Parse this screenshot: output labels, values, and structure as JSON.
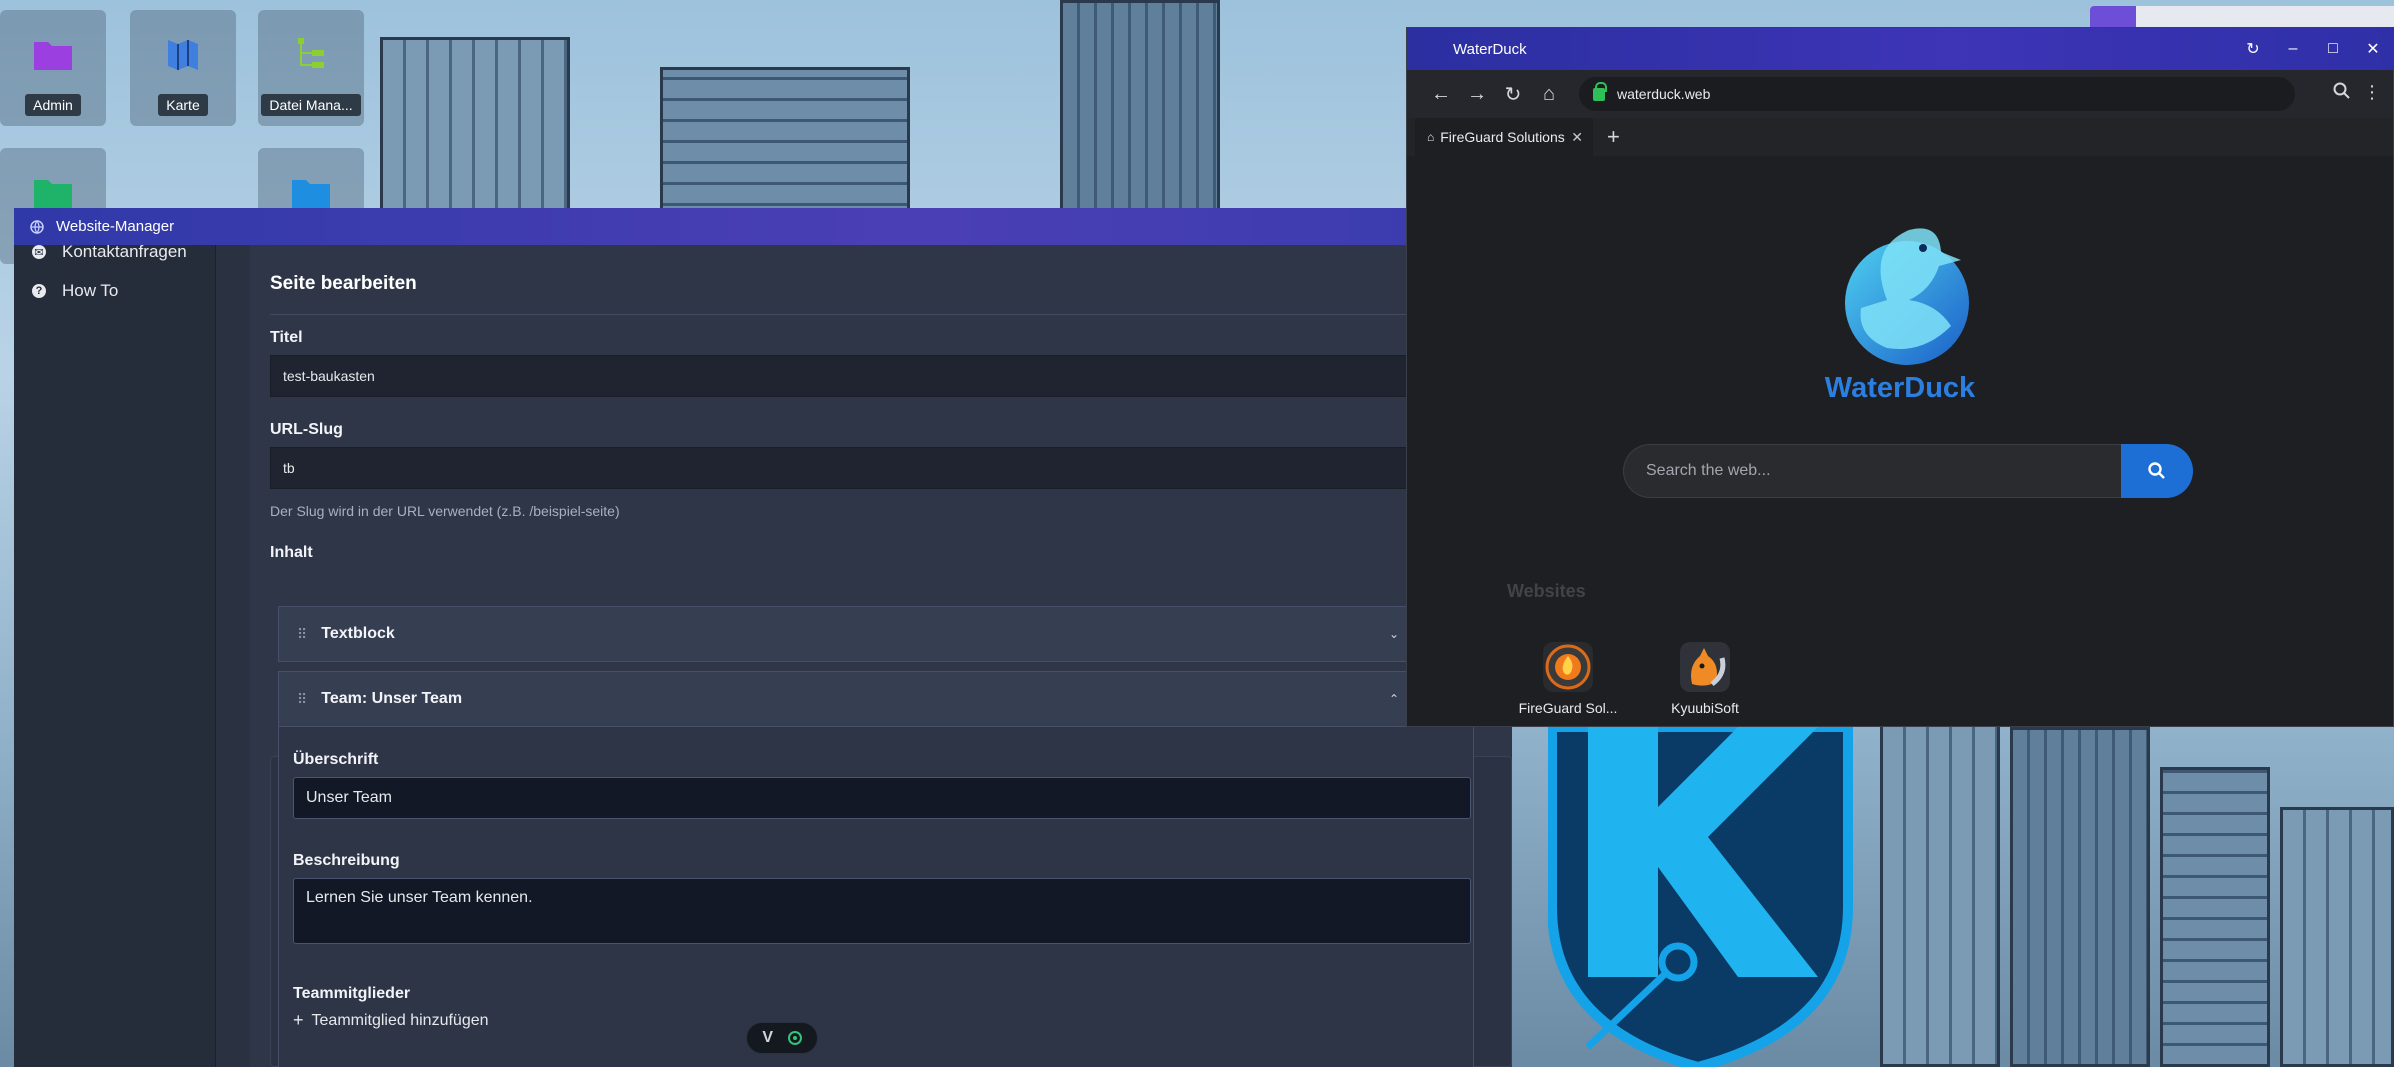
{
  "desktop": {
    "icons": [
      {
        "label": "Admin",
        "icon": "folder-icon",
        "color": "#9b3fe0"
      },
      {
        "label": "Karte",
        "icon": "map-icon",
        "color": "#3f7fe0"
      },
      {
        "label": "Datei Mana...",
        "icon": "file-tree-icon",
        "color": "#8bcf32"
      },
      {
        "label": "",
        "icon": "folder-icon",
        "color": "#1fb36a"
      },
      {
        "label": "",
        "icon": "folder-icon",
        "color": "#1e8fe0"
      }
    ]
  },
  "website_manager": {
    "title": "Website-Manager",
    "sidebar": [
      {
        "label": "Kontaktanfragen",
        "icon": "mail-icon"
      },
      {
        "label": "How To",
        "icon": "help-icon"
      }
    ],
    "section_title": "Seite bearbeiten",
    "fields": {
      "title_label": "Titel",
      "title_value": "test-baukasten",
      "slug_label": "URL-Slug",
      "slug_value": "tb",
      "slug_hint": "Der Slug wird in der URL verwendet (z.B. /beispiel-seite)",
      "content_label": "Inhalt"
    },
    "blocks": [
      {
        "label": "Textblock",
        "state": "collapsed"
      },
      {
        "label": "Team: Unser Team",
        "state": "expanded"
      }
    ],
    "team": {
      "heading_label": "Überschrift",
      "heading_value": "Unser Team",
      "description_label": "Beschreibung",
      "description_value": "Lernen Sie unser Team kennen.",
      "members_label": "Teammitglieder",
      "add_member_label": "Teammitglied hinzufügen"
    }
  },
  "floating_toolbar": {
    "left_label": "V"
  },
  "browser": {
    "title": "WaterDuck",
    "url": "waterduck.web",
    "tab_label": "FireGuard Solutions",
    "brand": "WaterDuck",
    "search_placeholder": "Search the web...",
    "websites_heading": "Websites",
    "websites": [
      {
        "label": "FireGuard Sol...",
        "icon": "fireguard-logo-icon"
      },
      {
        "label": "KyuubiSoft",
        "icon": "kyuubisoft-logo-icon"
      }
    ],
    "accent": "#1d6fd6"
  }
}
